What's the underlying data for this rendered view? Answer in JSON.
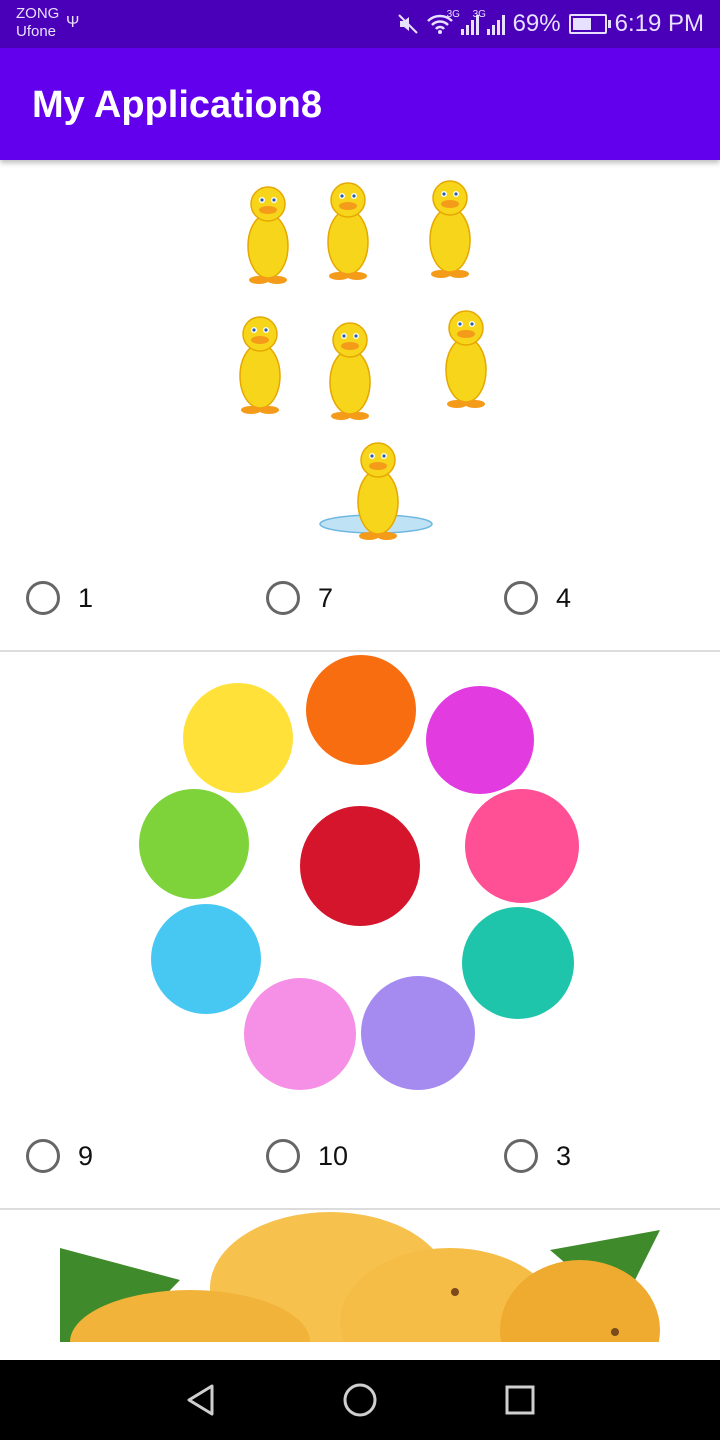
{
  "status_bar": {
    "carrier_1": "ZONG",
    "carrier_2": "Ufone",
    "signal_1_tag": "3G",
    "signal_2_tag": "3G",
    "battery": "69%",
    "battery_level": 0.69,
    "time": "6:19 PM"
  },
  "app_bar": {
    "title": "My Application8"
  },
  "questions": [
    {
      "image": "ducks-picture",
      "options": [
        "1",
        "7",
        "4"
      ]
    },
    {
      "image": "colored-circles-picture",
      "options": [
        "9",
        "10",
        "3"
      ]
    },
    {
      "image": "mangoes-picture",
      "options": []
    }
  ],
  "colors": {
    "app_bar": "#6200ee",
    "status_bar": "#4a00b8",
    "duck": "#f7d51b",
    "mango": "#f2b33a"
  },
  "nav_bar": {
    "buttons": [
      "back-icon",
      "home-icon",
      "recents-icon"
    ]
  }
}
